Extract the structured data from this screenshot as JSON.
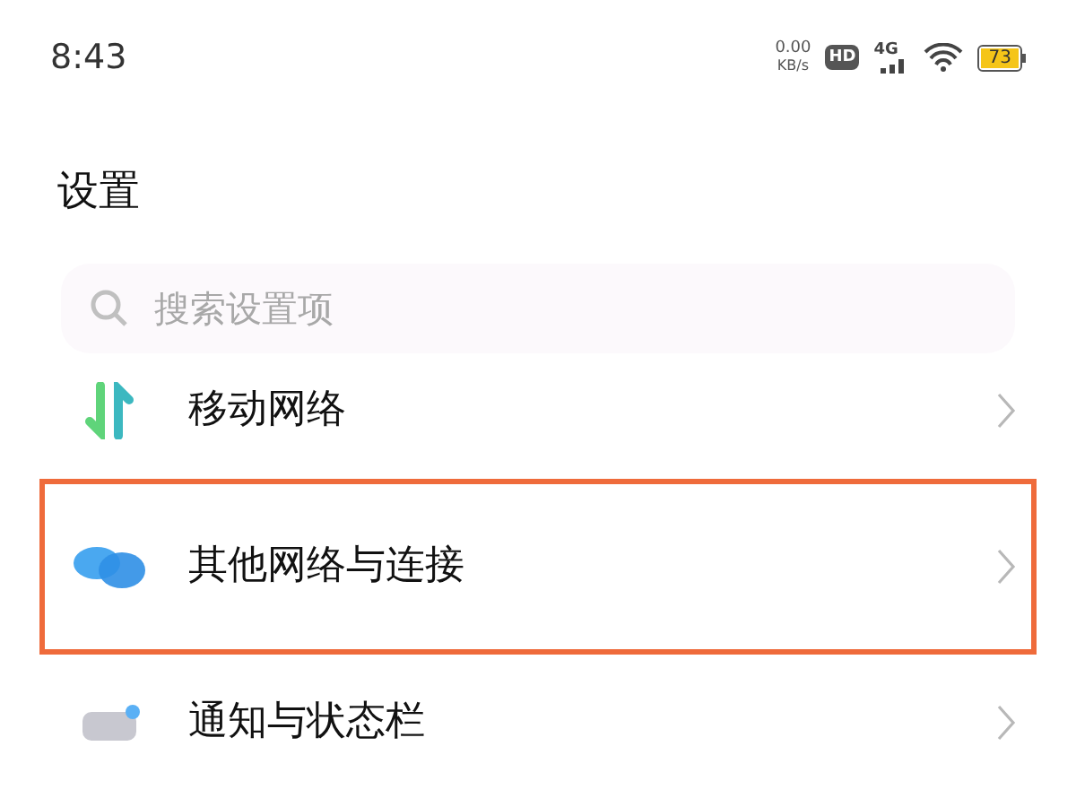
{
  "status_bar": {
    "time": "8:43",
    "speed_value": "0.00",
    "speed_unit": "KB/s",
    "hd_badge": "HD",
    "network": "4G",
    "battery": "73"
  },
  "title": "设置",
  "search": {
    "placeholder": "搜索设置项"
  },
  "items": [
    {
      "kind": "mobile",
      "label": "移动网络",
      "highlighted": false
    },
    {
      "kind": "connect",
      "label": "其他网络与连接",
      "highlighted": true
    },
    {
      "kind": "notify",
      "label": "通知与状态栏",
      "highlighted": false
    }
  ]
}
